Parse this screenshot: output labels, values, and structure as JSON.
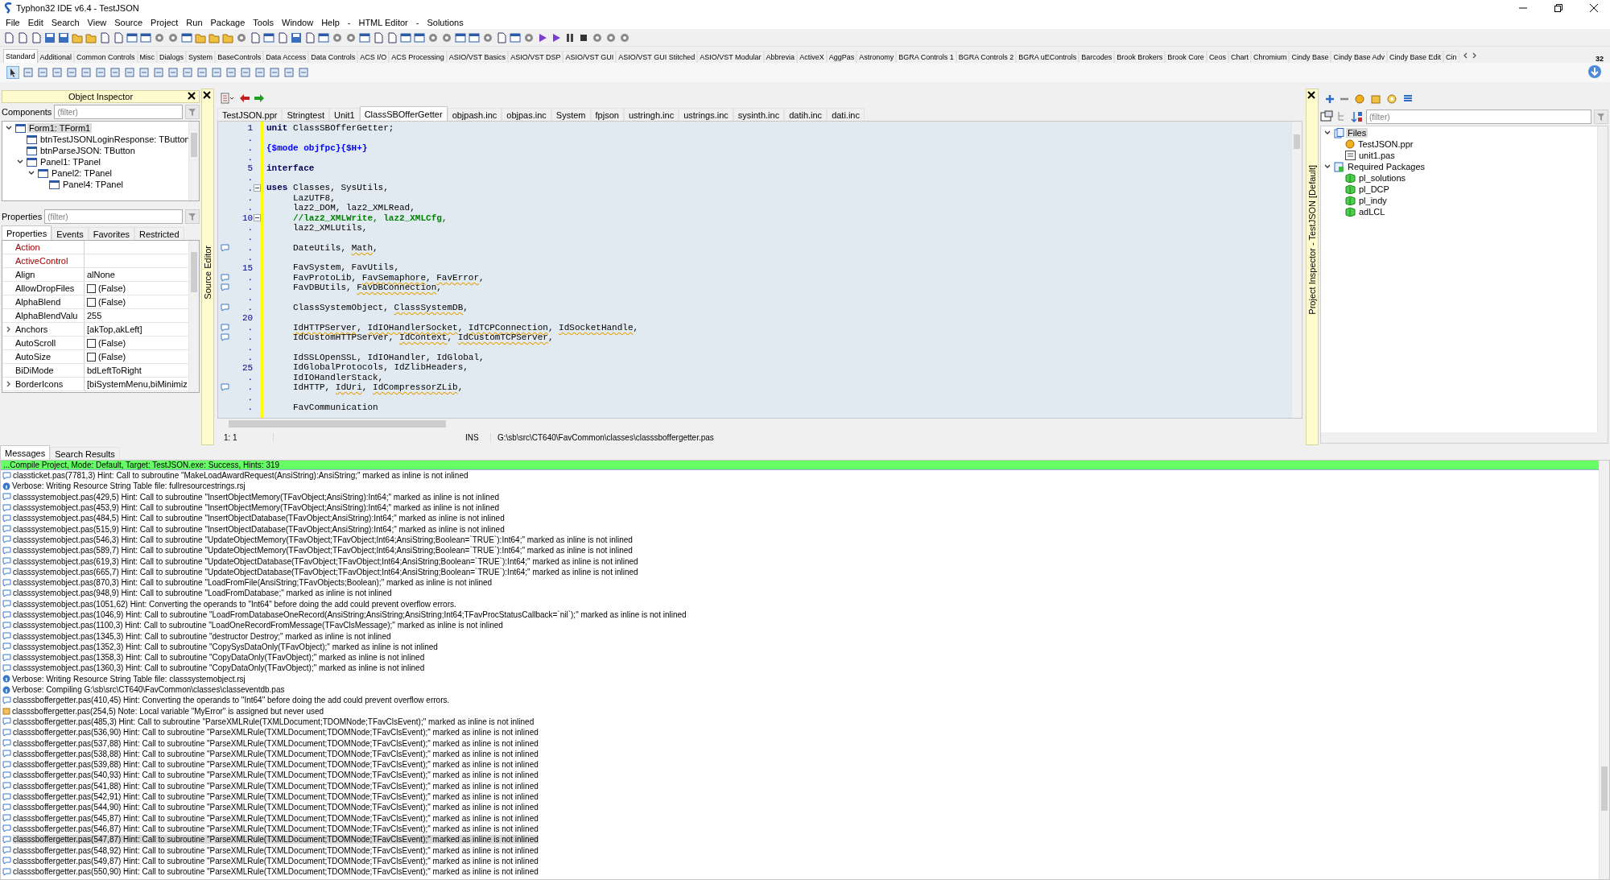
{
  "window": {
    "title": "Typhon32 IDE v6.4 - TestJSON"
  },
  "menu": [
    "File",
    "Edit",
    "Search",
    "View",
    "Source",
    "Project",
    "Run",
    "Package",
    "Tools",
    "Window",
    "Help",
    "-",
    "HTML Editor",
    "-",
    "Solutions"
  ],
  "palette_tabs": [
    {
      "label": "Standard",
      "selected": true
    },
    {
      "label": "Additional",
      "selected": false
    },
    {
      "label": "Common Controls",
      "selected": false
    },
    {
      "label": "Misc",
      "selected": false
    },
    {
      "label": "Dialogs",
      "selected": false
    },
    {
      "label": "System",
      "selected": false
    },
    {
      "label": "BaseControls",
      "selected": false
    },
    {
      "label": "Data Access",
      "selected": false
    },
    {
      "label": "Data Controls",
      "selected": false
    },
    {
      "label": "ACS I/O",
      "selected": false
    },
    {
      "label": "ACS Processing",
      "selected": false
    },
    {
      "label": "ASIO/VST Basics",
      "selected": false
    },
    {
      "label": "ASIO/VST DSP",
      "selected": false
    },
    {
      "label": "ASIO/VST GUI",
      "selected": false
    },
    {
      "label": "ASIO/VST GUI Stitched",
      "selected": false
    },
    {
      "label": "ASIO/VST Modular",
      "selected": false
    },
    {
      "label": "Abbrevia",
      "selected": false
    },
    {
      "label": "ActiveX",
      "selected": false
    },
    {
      "label": "AggPas",
      "selected": false
    },
    {
      "label": "Astronomy",
      "selected": false
    },
    {
      "label": "BGRA Controls 1",
      "selected": false
    },
    {
      "label": "BGRA Controls 2",
      "selected": false
    },
    {
      "label": "BGRA uEControls",
      "selected": false
    },
    {
      "label": "Barcodes",
      "selected": false
    },
    {
      "label": "Brook Brokers",
      "selected": false
    },
    {
      "label": "Brook Core",
      "selected": false
    },
    {
      "label": "Ceos",
      "selected": false
    },
    {
      "label": "Chart",
      "selected": false
    },
    {
      "label": "Chromium",
      "selected": false
    },
    {
      "label": "Cindy Base",
      "selected": false
    },
    {
      "label": "Cindy Base Adv",
      "selected": false
    },
    {
      "label": "Cindy Base Edit",
      "selected": false
    },
    {
      "label": "Cin",
      "selected": false
    }
  ],
  "palette_badge": "32",
  "object_inspector": {
    "title": "Object Inspector",
    "components_label": "Components",
    "components_filter": {
      "placeholder": "(filter)"
    },
    "tree": [
      {
        "label": "Form1: TForm1",
        "selected": true,
        "expanded": true,
        "children": [
          {
            "label": "btnTestJSONLoginResponse: TButton",
            "selected": false
          },
          {
            "label": "btnParseJSON: TButton",
            "selected": false
          },
          {
            "label": "Panel1: TPanel",
            "selected": false,
            "expanded": true,
            "children": [
              {
                "label": "Panel2: TPanel",
                "selected": false,
                "expanded": true,
                "children": [
                  {
                    "label": "Panel4: TPanel",
                    "selected": false
                  }
                ]
              }
            ]
          }
        ]
      }
    ],
    "properties_label": "Properties",
    "properties_filter": {
      "placeholder": "(filter)"
    },
    "tabs": [
      {
        "label": "Properties",
        "selected": true
      },
      {
        "label": "Events",
        "selected": false
      },
      {
        "label": "Favorites",
        "selected": false
      },
      {
        "label": "Restricted",
        "selected": false
      }
    ],
    "properties": [
      {
        "name": "Action",
        "kind": "reference",
        "expandable": false
      },
      {
        "name": "ActiveControl",
        "kind": "reference",
        "expandable": false
      },
      {
        "name": "Align",
        "kind": "text",
        "value": "alNone",
        "expandable": false
      },
      {
        "name": "AllowDropFiles",
        "kind": "check",
        "checked": false,
        "value": "(False)",
        "expandable": false
      },
      {
        "name": "AlphaBlend",
        "kind": "check",
        "checked": false,
        "value": "(False)",
        "expandable": false
      },
      {
        "name": "AlphaBlendValu",
        "kind": "text",
        "value": "255",
        "expandable": false
      },
      {
        "name": "Anchors",
        "kind": "text",
        "value": "[akTop,akLeft]",
        "expandable": true
      },
      {
        "name": "AutoScroll",
        "kind": "check",
        "checked": false,
        "value": "(False)",
        "expandable": false
      },
      {
        "name": "AutoSize",
        "kind": "check",
        "checked": false,
        "value": "(False)",
        "expandable": false
      },
      {
        "name": "BiDiMode",
        "kind": "text",
        "value": "bdLeftToRight",
        "expandable": false
      },
      {
        "name": "BorderIcons",
        "kind": "text",
        "value": "[biSystemMenu,biMinimiz",
        "expandable": true
      }
    ]
  },
  "source_editor": {
    "side_label": "Source Editor",
    "tabs": [
      {
        "label": "TestJSON.ppr",
        "selected": false
      },
      {
        "label": "Stringtest",
        "selected": false
      },
      {
        "label": "Unit1",
        "selected": false
      },
      {
        "label": "ClassSBOfferGetter",
        "selected": true
      },
      {
        "label": "objpash.inc",
        "selected": false
      },
      {
        "label": "objpas.inc",
        "selected": false
      },
      {
        "label": "System",
        "selected": false
      },
      {
        "label": "fpjson",
        "selected": false
      },
      {
        "label": "ustringh.inc",
        "selected": false
      },
      {
        "label": "ustrings.inc",
        "selected": false
      },
      {
        "label": "sysinth.inc",
        "selected": false
      },
      {
        "label": "datih.inc",
        "selected": false
      },
      {
        "label": "dati.inc",
        "selected": false
      }
    ],
    "lines": [
      {
        "gutter": "1",
        "hint": false,
        "fold": false,
        "indented": false,
        "segments": [
          {
            "text": "unit",
            "kind": "keyword"
          },
          {
            "text": " ClassSBOfferGetter;",
            "kind": "plain"
          }
        ]
      },
      {
        "gutter": ".",
        "hint": false,
        "fold": false
      },
      {
        "gutter": ".",
        "hint": false,
        "fold": false,
        "indented": false,
        "segments": [
          {
            "text": "{$mode objfpc}{$H+}",
            "kind": "directive"
          }
        ]
      },
      {
        "gutter": ".",
        "hint": false,
        "fold": false
      },
      {
        "gutter": "5",
        "hint": false,
        "fold": false,
        "indented": false,
        "segments": [
          {
            "text": "interface",
            "kind": "keyword"
          }
        ]
      },
      {
        "gutter": ".",
        "hint": false,
        "fold": false
      },
      {
        "gutter": ".",
        "hint": false,
        "fold": true,
        "indented": false,
        "segments": [
          {
            "text": "uses",
            "kind": "keyword"
          },
          {
            "text": " Classes, SysUtils,",
            "kind": "plain"
          }
        ]
      },
      {
        "gutter": ".",
        "hint": false,
        "fold": false,
        "segments": [
          {
            "text": "LazUTF8,",
            "kind": "plain"
          }
        ],
        "indented": true
      },
      {
        "gutter": ".",
        "hint": false,
        "fold": false,
        "segments": [
          {
            "text": "laz2_DOM, laz2_XMLRead,",
            "kind": "plain"
          }
        ],
        "indented": true
      },
      {
        "gutter": "10",
        "hint": false,
        "fold": true,
        "segments": [
          {
            "text": "//laz2_XMLWrite, laz2_XMLCfg,",
            "kind": "comment"
          }
        ],
        "indented": true
      },
      {
        "gutter": ".",
        "hint": false,
        "fold": false,
        "segments": [
          {
            "text": "laz2_XMLUtils,",
            "kind": "plain"
          }
        ],
        "indented": true
      },
      {
        "gutter": ".",
        "hint": false,
        "fold": false
      },
      {
        "gutter": ".",
        "hint": true,
        "fold": false,
        "segments": [
          {
            "text": "DateUtils, ",
            "kind": "plain"
          },
          {
            "text": "Math",
            "kind": "warning"
          },
          {
            "text": ",",
            "kind": "plain"
          }
        ],
        "indented": true
      },
      {
        "gutter": ".",
        "hint": false,
        "fold": false
      },
      {
        "gutter": "15",
        "hint": false,
        "fold": false,
        "segments": [
          {
            "text": "FavSystem, FavUtils,",
            "kind": "plain"
          }
        ],
        "indented": true
      },
      {
        "gutter": ".",
        "hint": true,
        "fold": false,
        "segments": [
          {
            "text": "FavProtoLib, ",
            "kind": "plain"
          },
          {
            "text": "FavSemaphore",
            "kind": "warning"
          },
          {
            "text": ", ",
            "kind": "plain"
          },
          {
            "text": "FavError",
            "kind": "warning"
          },
          {
            "text": ",",
            "kind": "plain"
          }
        ],
        "indented": true
      },
      {
        "gutter": ".",
        "hint": true,
        "fold": false,
        "segments": [
          {
            "text": "FavDBUtils, ",
            "kind": "plain"
          },
          {
            "text": "FavDBConnection",
            "kind": "warning"
          },
          {
            "text": ",",
            "kind": "plain"
          }
        ],
        "indented": true
      },
      {
        "gutter": ".",
        "hint": false,
        "fold": false
      },
      {
        "gutter": ".",
        "hint": true,
        "fold": false,
        "segments": [
          {
            "text": "ClassSystemObject, ",
            "kind": "plain"
          },
          {
            "text": "ClassSystemDB",
            "kind": "warning"
          },
          {
            "text": ",",
            "kind": "plain"
          }
        ],
        "indented": true
      },
      {
        "gutter": "20",
        "hint": false,
        "fold": false
      },
      {
        "gutter": ".",
        "hint": true,
        "fold": false,
        "indented": true,
        "segments": [
          {
            "text": "IdHTTPServer",
            "kind": "warning"
          },
          {
            "text": ", ",
            "kind": "plain"
          },
          {
            "text": "IdIOHandlerSocket",
            "kind": "warning"
          },
          {
            "text": ", ",
            "kind": "plain"
          },
          {
            "text": "IdTCPConnection",
            "kind": "warning"
          },
          {
            "text": ", ",
            "kind": "plain"
          },
          {
            "text": "IdSocketHandle",
            "kind": "warning"
          },
          {
            "text": ",",
            "kind": "plain"
          }
        ]
      },
      {
        "gutter": ".",
        "hint": true,
        "fold": false,
        "indented": true,
        "segments": [
          {
            "text": "IdCustomHTTPServer, ",
            "kind": "plain"
          },
          {
            "text": "IdContext",
            "kind": "warning"
          },
          {
            "text": ", ",
            "kind": "plain"
          },
          {
            "text": "IdCustomTCPServer",
            "kind": "warning"
          },
          {
            "text": ",",
            "kind": "plain"
          }
        ]
      },
      {
        "gutter": ".",
        "hint": false,
        "fold": false
      },
      {
        "gutter": ".",
        "hint": false,
        "fold": false,
        "segments": [
          {
            "text": "IdSSLOpenSSL, IdIOHandler, IdGlobal,",
            "kind": "plain"
          }
        ],
        "indented": true
      },
      {
        "gutter": "25",
        "hint": false,
        "fold": false,
        "segments": [
          {
            "text": "IdGlobalProtocols, IdZlibHeaders,",
            "kind": "plain"
          }
        ],
        "indented": true
      },
      {
        "gutter": ".",
        "hint": false,
        "fold": false,
        "segments": [
          {
            "text": "IdIOHandlerStack,",
            "kind": "plain"
          }
        ],
        "indented": true
      },
      {
        "gutter": ".",
        "hint": true,
        "fold": false,
        "indented": true,
        "segments": [
          {
            "text": "IdHTTP, ",
            "kind": "plain"
          },
          {
            "text": "IdUri",
            "kind": "warning"
          },
          {
            "text": ", ",
            "kind": "plain"
          },
          {
            "text": "IdCompressorZLib",
            "kind": "warning"
          },
          {
            "text": ",",
            "kind": "plain"
          }
        ]
      },
      {
        "gutter": ".",
        "hint": false,
        "fold": false
      },
      {
        "gutter": ".",
        "hint": false,
        "fold": false,
        "segments": [
          {
            "text": "FavCommunication",
            "kind": "plain"
          }
        ],
        "indented": true
      }
    ],
    "status": {
      "position": "1: 1",
      "mode": "INS",
      "path": "G:\\sb\\src\\CT640\\FavCommon\\classes\\classsboffergetter.pas"
    }
  },
  "project_inspector": {
    "side_label": "Project Inspector - TestJSON [Default]",
    "filter": {
      "placeholder": "(filter)"
    },
    "tree": [
      {
        "label": "Files",
        "kind": "folder",
        "selected": true,
        "expanded": true,
        "children": [
          {
            "label": "TestJSON.ppr",
            "kind": "project",
            "selected": false
          },
          {
            "label": "unit1.pas",
            "kind": "unit",
            "selected": false
          }
        ]
      },
      {
        "label": "Required Packages",
        "kind": "packages",
        "selected": false,
        "expanded": true,
        "children": [
          {
            "label": "pl_solutions",
            "kind": "package",
            "selected": false
          },
          {
            "label": "pl_DCP",
            "kind": "package",
            "selected": false
          },
          {
            "label": "pl_indy",
            "kind": "package",
            "selected": false
          },
          {
            "label": "adLCL",
            "kind": "package",
            "selected": false
          }
        ]
      }
    ]
  },
  "messages": {
    "tabs": [
      {
        "label": "Messages",
        "selected": true
      },
      {
        "label": "Search Results",
        "selected": false
      }
    ],
    "summary": "...Compile Project, Mode: Default, Target: TestJSON.exe: Success, Hints: 319",
    "items": [
      {
        "kind": "hint",
        "selected": false,
        "text": "classticket.pas(7781,3) Hint: Call to subroutine \"MakeLoadAwardRequest(AnsiString):AnsiString;\" marked as inline is not inlined"
      },
      {
        "kind": "info",
        "selected": false,
        "text": "Verbose: Writing Resource String Table file: fullresourcestrings.rsj"
      },
      {
        "kind": "hint",
        "selected": false,
        "text": "classsystemobject.pas(429,5) Hint: Call to subroutine \"InsertObjectMemory(TFavObject;AnsiString):Int64;\" marked as inline is not inlined"
      },
      {
        "kind": "hint",
        "selected": false,
        "text": "classsystemobject.pas(453,9) Hint: Call to subroutine \"InsertObjectMemory(TFavObject;AnsiString):Int64;\" marked as inline is not inlined"
      },
      {
        "kind": "hint",
        "selected": false,
        "text": "classsystemobject.pas(484,5) Hint: Call to subroutine \"InsertObjectDatabase(TFavObject;AnsiString):Int64;\" marked as inline is not inlined"
      },
      {
        "kind": "hint",
        "selected": false,
        "text": "classsystemobject.pas(515,9) Hint: Call to subroutine \"InsertObjectDatabase(TFavObject;AnsiString):Int64;\" marked as inline is not inlined"
      },
      {
        "kind": "hint",
        "selected": false,
        "text": "classsystemobject.pas(546,3) Hint: Call to subroutine \"UpdateObjectMemory(TFavObject;TFavObject;Int64;AnsiString;Boolean=`TRUE`):Int64;\" marked as inline is not inlined"
      },
      {
        "kind": "hint",
        "selected": false,
        "text": "classsystemobject.pas(589,7) Hint: Call to subroutine \"UpdateObjectMemory(TFavObject;TFavObject;Int64;AnsiString;Boolean=`TRUE`):Int64;\" marked as inline is not inlined"
      },
      {
        "kind": "hint",
        "selected": false,
        "text": "classsystemobject.pas(619,3) Hint: Call to subroutine \"UpdateObjectDatabase(TFavObject;TFavObject;Int64;AnsiString;Boolean=`TRUE`):Int64;\" marked as inline is not inlined"
      },
      {
        "kind": "hint",
        "selected": false,
        "text": "classsystemobject.pas(665,7) Hint: Call to subroutine \"UpdateObjectDatabase(TFavObject;TFavObject;Int64;AnsiString;Boolean=`TRUE`):Int64;\" marked as inline is not inlined"
      },
      {
        "kind": "hint",
        "selected": false,
        "text": "classsystemobject.pas(870,3) Hint: Call to subroutine \"LoadFromFile(AnsiString;TFavObjects;Boolean);\" marked as inline is not inlined"
      },
      {
        "kind": "hint",
        "selected": false,
        "text": "classsystemobject.pas(948,9) Hint: Call to subroutine \"LoadFromDatabase;\" marked as inline is not inlined"
      },
      {
        "kind": "hint",
        "selected": false,
        "text": "classsystemobject.pas(1051,62) Hint: Converting the operands to \"Int64\" before doing the add could prevent overflow errors."
      },
      {
        "kind": "hint",
        "selected": false,
        "text": "classsystemobject.pas(1046,9) Hint: Call to subroutine \"LoadFromDatabaseOneRecord(AnsiString;AnsiString;AnsiString;Int64;TFavProcStatusCallback=`nil`);\" marked as inline is not inlined"
      },
      {
        "kind": "hint",
        "selected": false,
        "text": "classsystemobject.pas(1100,3) Hint: Call to subroutine \"LoadOneRecordFromMessage(TFavClsMessage);\" marked as inline is not inlined"
      },
      {
        "kind": "hint",
        "selected": false,
        "text": "classsystemobject.pas(1345,3) Hint: Call to subroutine \"destructor Destroy;\" marked as inline is not inlined"
      },
      {
        "kind": "hint",
        "selected": false,
        "text": "classsystemobject.pas(1352,3) Hint: Call to subroutine \"CopySysDataOnly(TFavObject);\" marked as inline is not inlined"
      },
      {
        "kind": "hint",
        "selected": false,
        "text": "classsystemobject.pas(1358,3) Hint: Call to subroutine \"CopyDataOnly(TFavObject);\" marked as inline is not inlined"
      },
      {
        "kind": "hint",
        "selected": false,
        "text": "classsystemobject.pas(1360,3) Hint: Call to subroutine \"CopyDataOnly(TFavObject);\" marked as inline is not inlined"
      },
      {
        "kind": "info",
        "selected": false,
        "text": "Verbose: Writing Resource String Table file: classsystemobject.rsj"
      },
      {
        "kind": "info",
        "selected": false,
        "text": "Verbose: Compiling G:\\sb\\src\\CT640\\FavCommon\\classes\\classeventdb.pas"
      },
      {
        "kind": "hint",
        "selected": false,
        "text": "classsboffergetter.pas(410,45) Hint: Converting the operands to \"Int64\" before doing the add could prevent overflow errors."
      },
      {
        "kind": "note",
        "selected": false,
        "text": "classsboffergetter.pas(254,5) Note: Local variable \"MyError\" is assigned but never used"
      },
      {
        "kind": "hint",
        "selected": false,
        "text": "classsboffergetter.pas(485,3) Hint: Call to subroutine \"ParseXMLRule(TXMLDocument;TDOMNode;TFavClsEvent);\" marked as inline is not inlined"
      },
      {
        "kind": "hint",
        "selected": false,
        "text": "classsboffergetter.pas(536,90) Hint: Call to subroutine \"ParseXMLRule(TXMLDocument;TDOMNode;TFavClsEvent);\" marked as inline is not inlined"
      },
      {
        "kind": "hint",
        "selected": false,
        "text": "classsboffergetter.pas(537,88) Hint: Call to subroutine \"ParseXMLRule(TXMLDocument;TDOMNode;TFavClsEvent);\" marked as inline is not inlined"
      },
      {
        "kind": "hint",
        "selected": false,
        "text": "classsboffergetter.pas(538,88) Hint: Call to subroutine \"ParseXMLRule(TXMLDocument;TDOMNode;TFavClsEvent);\" marked as inline is not inlined"
      },
      {
        "kind": "hint",
        "selected": false,
        "text": "classsboffergetter.pas(539,88) Hint: Call to subroutine \"ParseXMLRule(TXMLDocument;TDOMNode;TFavClsEvent);\" marked as inline is not inlined"
      },
      {
        "kind": "hint",
        "selected": false,
        "text": "classsboffergetter.pas(540,93) Hint: Call to subroutine \"ParseXMLRule(TXMLDocument;TDOMNode;TFavClsEvent);\" marked as inline is not inlined"
      },
      {
        "kind": "hint",
        "selected": false,
        "text": "classsboffergetter.pas(541,88) Hint: Call to subroutine \"ParseXMLRule(TXMLDocument;TDOMNode;TFavClsEvent);\" marked as inline is not inlined"
      },
      {
        "kind": "hint",
        "selected": false,
        "text": "classsboffergetter.pas(542,91) Hint: Call to subroutine \"ParseXMLRule(TXMLDocument;TDOMNode;TFavClsEvent);\" marked as inline is not inlined"
      },
      {
        "kind": "hint",
        "selected": false,
        "text": "classsboffergetter.pas(544,90) Hint: Call to subroutine \"ParseXMLRule(TXMLDocument;TDOMNode;TFavClsEvent);\" marked as inline is not inlined"
      },
      {
        "kind": "hint",
        "selected": false,
        "text": "classsboffergetter.pas(545,87) Hint: Call to subroutine \"ParseXMLRule(TXMLDocument;TDOMNode;TFavClsEvent);\" marked as inline is not inlined"
      },
      {
        "kind": "hint",
        "selected": false,
        "text": "classsboffergetter.pas(546,87) Hint: Call to subroutine \"ParseXMLRule(TXMLDocument;TDOMNode;TFavClsEvent);\" marked as inline is not inlined"
      },
      {
        "kind": "hint",
        "selected": true,
        "text": "classsboffergetter.pas(547,87) Hint: Call to subroutine \"ParseXMLRule(TXMLDocument;TDOMNode;TFavClsEvent);\" marked as inline is not inlined"
      },
      {
        "kind": "hint",
        "selected": false,
        "text": "classsboffergetter.pas(548,92) Hint: Call to subroutine \"ParseXMLRule(TXMLDocument;TDOMNode;TFavClsEvent);\" marked as inline is not inlined"
      },
      {
        "kind": "hint",
        "selected": false,
        "text": "classsboffergetter.pas(549,87) Hint: Call to subroutine \"ParseXMLRule(TXMLDocument;TDOMNode;TFavClsEvent);\" marked as inline is not inlined"
      },
      {
        "kind": "hint",
        "selected": false,
        "text": "classsboffergetter.pas(550,90) Hint: Call to subroutine \"ParseXMLRule(TXMLDocument;TDOMNode;TFavClsEvent);\" marked as inline is not inlined"
      }
    ]
  }
}
